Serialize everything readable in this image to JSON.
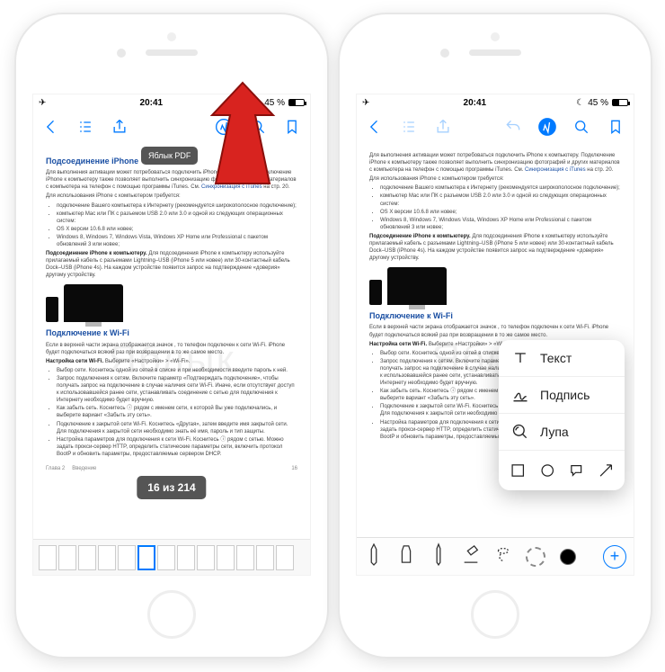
{
  "status": {
    "time": "20:41",
    "battery_pct": "45 %"
  },
  "left": {
    "doc_tag": "Яблык PDF",
    "page_indicator": "16 из 214",
    "sections": {
      "connect_iphone_h": "Подсоединение iPhone",
      "connect_iphone_p1": "Для выполнения активации может потребоваться подключить iPhone к компьютеру. Подключение iPhone к компьютеру также позволяет выполнить синхронизацию фотографий и других материалов с компьютера на телефон с помощью программы iTunes. См.",
      "sync_link": "Синхронизация с iTunes",
      "sync_tail": " на стр. 20.",
      "req_intro": "Для использования iPhone с компьютером требуется:",
      "req_items": [
        "подключение Вашего компьютера к Интернету (рекомендуется широкополосное подключение);",
        "компьютер Mac или ПК с разъемом USB 2.0 или 3.0 и одной из следующих операционных систем:",
        "OS X версии 10.6.8 или новее;",
        "Windows 8, Windows 7, Windows Vista, Windows XP Home или Professional с пакетом обновлений 3 или новее;"
      ],
      "conn_pc_h": "Подсоединение iPhone к компьютеру.",
      "conn_pc_p": "Для подсоединения iPhone к компьютеру используйте прилагаемый кабель с разъемами Lightning–USB (iPhone 5 или новее) или 30-контактный кабель Dock–USB (iPhone 4s). На каждом устройстве появится запрос на подтверждение «доверия» другому устройству.",
      "wifi_h": "Подключение к Wi-Fi",
      "wifi_p1": "Если в верхней части экрана отображается значок , то телефон подключен к сети Wi-Fi. iPhone будет подключаться всякий раз при возвращении в то же самое место.",
      "wifi_cfg_h": "Настройка сети Wi-Fi.",
      "wifi_cfg_p": "Выберите «Настройки» > «Wi-Fi».",
      "wifi_items": [
        "Выбор сети. Коснитесь одной из сетей в списке и при необходимости введите пароль к ней.",
        "Запрос подключения к сетям. Включите параметр «Подтверждать подключение», чтобы получать запрос на подключение в случае наличия сети Wi-Fi. Иначе, если отсутствует доступ к использовавшейся ранее сети, устанавливать соединение с сетью для подключения к Интернету необходимо будет вручную.",
        "Как забыть сеть. Коснитесь ⓘ рядом с именем сети, к которой Вы уже подключались, и выберите вариант «Забыть эту сеть».",
        "Подключение к закрытой сети Wi-Fi. Коснитесь «Другая», затем введите имя закрытой сети. Для подключения к закрытой сети необходимо знать её имя, пароль и тип защиты.",
        "Настройка параметров для подключения к сети Wi-Fi. Коснитесь ⓘ рядом с сетью. Можно задать прокси-сервер HTTP, определить статические параметры сети, включить протокол BootP и обновить параметры, предоставляемые сервером DHCP."
      ],
      "footer_chapter": "Глава 2",
      "footer_section": "Введение",
      "footer_page": "16"
    }
  },
  "popup": {
    "text": "Текст",
    "signature": "Подпись",
    "loupe": "Лупа"
  }
}
